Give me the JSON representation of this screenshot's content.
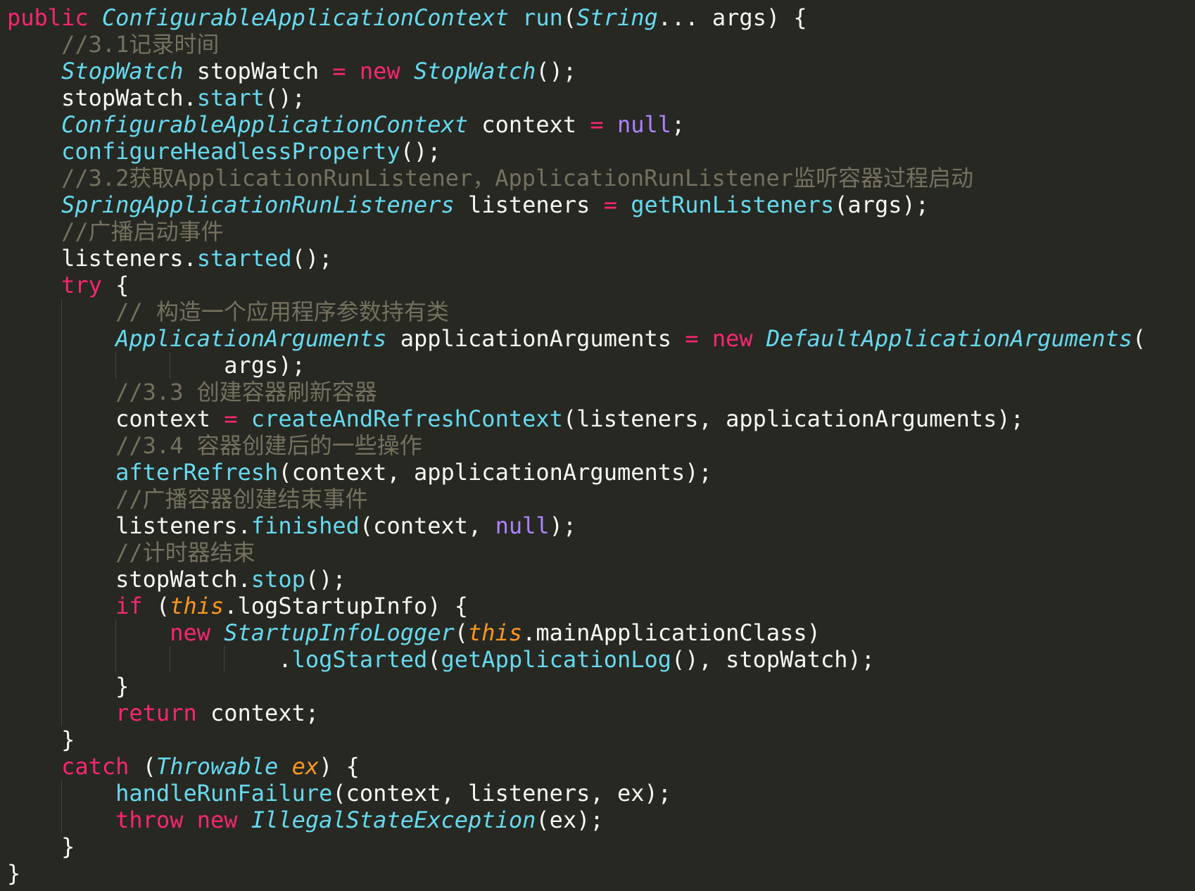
{
  "theme": {
    "background": "#272822",
    "foreground": "#f8f8f2",
    "keyword": "#f92672",
    "type": "#66d9ef",
    "method": "#66d9ef",
    "param": "#fd971f",
    "constant": "#ae81ff",
    "comment": "#75715e",
    "indent_guide": "#444444"
  },
  "code": {
    "language": "java",
    "lines": [
      {
        "indent": 0,
        "tokens": [
          {
            "kind": "keyword",
            "text": "public "
          },
          {
            "kind": "type",
            "text": "ConfigurableApplicationContext"
          },
          {
            "kind": "plain",
            "text": " "
          },
          {
            "kind": "method",
            "text": "run"
          },
          {
            "kind": "plain",
            "text": "("
          },
          {
            "kind": "type",
            "text": "String"
          },
          {
            "kind": "plain",
            "text": "... args) {"
          }
        ]
      },
      {
        "indent": 1,
        "tokens": [
          {
            "kind": "comment",
            "text": "//3.1记录时间"
          }
        ]
      },
      {
        "indent": 1,
        "tokens": [
          {
            "kind": "type",
            "text": "StopWatch"
          },
          {
            "kind": "plain",
            "text": " stopWatch "
          },
          {
            "kind": "op",
            "text": "="
          },
          {
            "kind": "plain",
            "text": " "
          },
          {
            "kind": "keyword",
            "text": "new"
          },
          {
            "kind": "plain",
            "text": " "
          },
          {
            "kind": "type",
            "text": "StopWatch"
          },
          {
            "kind": "plain",
            "text": "();"
          }
        ]
      },
      {
        "indent": 1,
        "tokens": [
          {
            "kind": "plain",
            "text": "stopWatch."
          },
          {
            "kind": "method",
            "text": "start"
          },
          {
            "kind": "plain",
            "text": "();"
          }
        ]
      },
      {
        "indent": 1,
        "tokens": [
          {
            "kind": "type",
            "text": "ConfigurableApplicationContext"
          },
          {
            "kind": "plain",
            "text": " context "
          },
          {
            "kind": "op",
            "text": "="
          },
          {
            "kind": "plain",
            "text": " "
          },
          {
            "kind": "constant",
            "text": "null"
          },
          {
            "kind": "plain",
            "text": ";"
          }
        ]
      },
      {
        "indent": 1,
        "tokens": [
          {
            "kind": "method",
            "text": "configureHeadlessProperty"
          },
          {
            "kind": "plain",
            "text": "();"
          }
        ]
      },
      {
        "indent": 1,
        "tokens": [
          {
            "kind": "comment",
            "text": "//3.2获取ApplicationRunListener，ApplicationRunListener监听容器过程启动"
          }
        ]
      },
      {
        "indent": 1,
        "tokens": [
          {
            "kind": "type",
            "text": "SpringApplicationRunListeners"
          },
          {
            "kind": "plain",
            "text": " listeners "
          },
          {
            "kind": "op",
            "text": "="
          },
          {
            "kind": "plain",
            "text": " "
          },
          {
            "kind": "method",
            "text": "getRunListeners"
          },
          {
            "kind": "plain",
            "text": "(args);"
          }
        ]
      },
      {
        "indent": 1,
        "tokens": [
          {
            "kind": "comment",
            "text": "//广播启动事件"
          }
        ]
      },
      {
        "indent": 1,
        "tokens": [
          {
            "kind": "plain",
            "text": "listeners."
          },
          {
            "kind": "method",
            "text": "started"
          },
          {
            "kind": "plain",
            "text": "();"
          }
        ]
      },
      {
        "indent": 1,
        "tokens": [
          {
            "kind": "keyword",
            "text": "try"
          },
          {
            "kind": "plain",
            "text": " {"
          }
        ]
      },
      {
        "indent": 2,
        "tokens": [
          {
            "kind": "comment",
            "text": "// 构造一个应用程序参数持有类"
          }
        ]
      },
      {
        "indent": 2,
        "tokens": [
          {
            "kind": "type",
            "text": "ApplicationArguments"
          },
          {
            "kind": "plain",
            "text": " applicationArguments "
          },
          {
            "kind": "op",
            "text": "="
          },
          {
            "kind": "plain",
            "text": " "
          },
          {
            "kind": "keyword",
            "text": "new"
          },
          {
            "kind": "plain",
            "text": " "
          },
          {
            "kind": "type",
            "text": "DefaultApplicationArguments"
          },
          {
            "kind": "plain",
            "text": "("
          }
        ]
      },
      {
        "indent": 4,
        "tokens": [
          {
            "kind": "plain",
            "text": "args);"
          }
        ]
      },
      {
        "indent": 2,
        "tokens": [
          {
            "kind": "comment",
            "text": "//3.3 创建容器刷新容器"
          }
        ]
      },
      {
        "indent": 2,
        "tokens": [
          {
            "kind": "plain",
            "text": "context "
          },
          {
            "kind": "op",
            "text": "="
          },
          {
            "kind": "plain",
            "text": " "
          },
          {
            "kind": "method",
            "text": "createAndRefreshContext"
          },
          {
            "kind": "plain",
            "text": "(listeners, applicationArguments);"
          }
        ]
      },
      {
        "indent": 2,
        "tokens": [
          {
            "kind": "comment",
            "text": "//3.4 容器创建后的一些操作"
          }
        ]
      },
      {
        "indent": 2,
        "tokens": [
          {
            "kind": "method",
            "text": "afterRefresh"
          },
          {
            "kind": "plain",
            "text": "(context, applicationArguments);"
          }
        ]
      },
      {
        "indent": 2,
        "tokens": [
          {
            "kind": "comment",
            "text": "//广播容器创建结束事件"
          }
        ]
      },
      {
        "indent": 2,
        "tokens": [
          {
            "kind": "plain",
            "text": "listeners."
          },
          {
            "kind": "method",
            "text": "finished"
          },
          {
            "kind": "plain",
            "text": "(context, "
          },
          {
            "kind": "constant",
            "text": "null"
          },
          {
            "kind": "plain",
            "text": ");"
          }
        ]
      },
      {
        "indent": 2,
        "tokens": [
          {
            "kind": "comment",
            "text": "//计时器结束"
          }
        ]
      },
      {
        "indent": 2,
        "tokens": [
          {
            "kind": "plain",
            "text": "stopWatch."
          },
          {
            "kind": "method",
            "text": "stop"
          },
          {
            "kind": "plain",
            "text": "();"
          }
        ]
      },
      {
        "indent": 2,
        "tokens": [
          {
            "kind": "keyword",
            "text": "if"
          },
          {
            "kind": "plain",
            "text": " ("
          },
          {
            "kind": "this",
            "text": "this"
          },
          {
            "kind": "plain",
            "text": ".logStartupInfo) {"
          }
        ]
      },
      {
        "indent": 3,
        "tokens": [
          {
            "kind": "keyword",
            "text": "new"
          },
          {
            "kind": "plain",
            "text": " "
          },
          {
            "kind": "type",
            "text": "StartupInfoLogger"
          },
          {
            "kind": "plain",
            "text": "("
          },
          {
            "kind": "this",
            "text": "this"
          },
          {
            "kind": "plain",
            "text": ".mainApplicationClass)"
          }
        ]
      },
      {
        "indent": 5,
        "tokens": [
          {
            "kind": "plain",
            "text": "."
          },
          {
            "kind": "method",
            "text": "logStarted"
          },
          {
            "kind": "plain",
            "text": "("
          },
          {
            "kind": "method",
            "text": "getApplicationLog"
          },
          {
            "kind": "plain",
            "text": "(), stopWatch);"
          }
        ]
      },
      {
        "indent": 2,
        "tokens": [
          {
            "kind": "plain",
            "text": "}"
          }
        ]
      },
      {
        "indent": 2,
        "tokens": [
          {
            "kind": "keyword",
            "text": "return"
          },
          {
            "kind": "plain",
            "text": " context;"
          }
        ]
      },
      {
        "indent": 1,
        "tokens": [
          {
            "kind": "plain",
            "text": "}"
          }
        ]
      },
      {
        "indent": 1,
        "tokens": [
          {
            "kind": "keyword",
            "text": "catch"
          },
          {
            "kind": "plain",
            "text": " ("
          },
          {
            "kind": "type",
            "text": "Throwable"
          },
          {
            "kind": "plain",
            "text": " "
          },
          {
            "kind": "param",
            "text": "ex"
          },
          {
            "kind": "plain",
            "text": ") {"
          }
        ]
      },
      {
        "indent": 2,
        "tokens": [
          {
            "kind": "method",
            "text": "handleRunFailure"
          },
          {
            "kind": "plain",
            "text": "(context, listeners, ex);"
          }
        ]
      },
      {
        "indent": 2,
        "tokens": [
          {
            "kind": "keyword",
            "text": "throw"
          },
          {
            "kind": "plain",
            "text": " "
          },
          {
            "kind": "keyword",
            "text": "new"
          },
          {
            "kind": "plain",
            "text": " "
          },
          {
            "kind": "type",
            "text": "IllegalStateException"
          },
          {
            "kind": "plain",
            "text": "(ex);"
          }
        ]
      },
      {
        "indent": 1,
        "tokens": [
          {
            "kind": "plain",
            "text": "}"
          }
        ]
      },
      {
        "indent": 0,
        "tokens": [
          {
            "kind": "plain",
            "text": "}"
          }
        ]
      }
    ]
  }
}
